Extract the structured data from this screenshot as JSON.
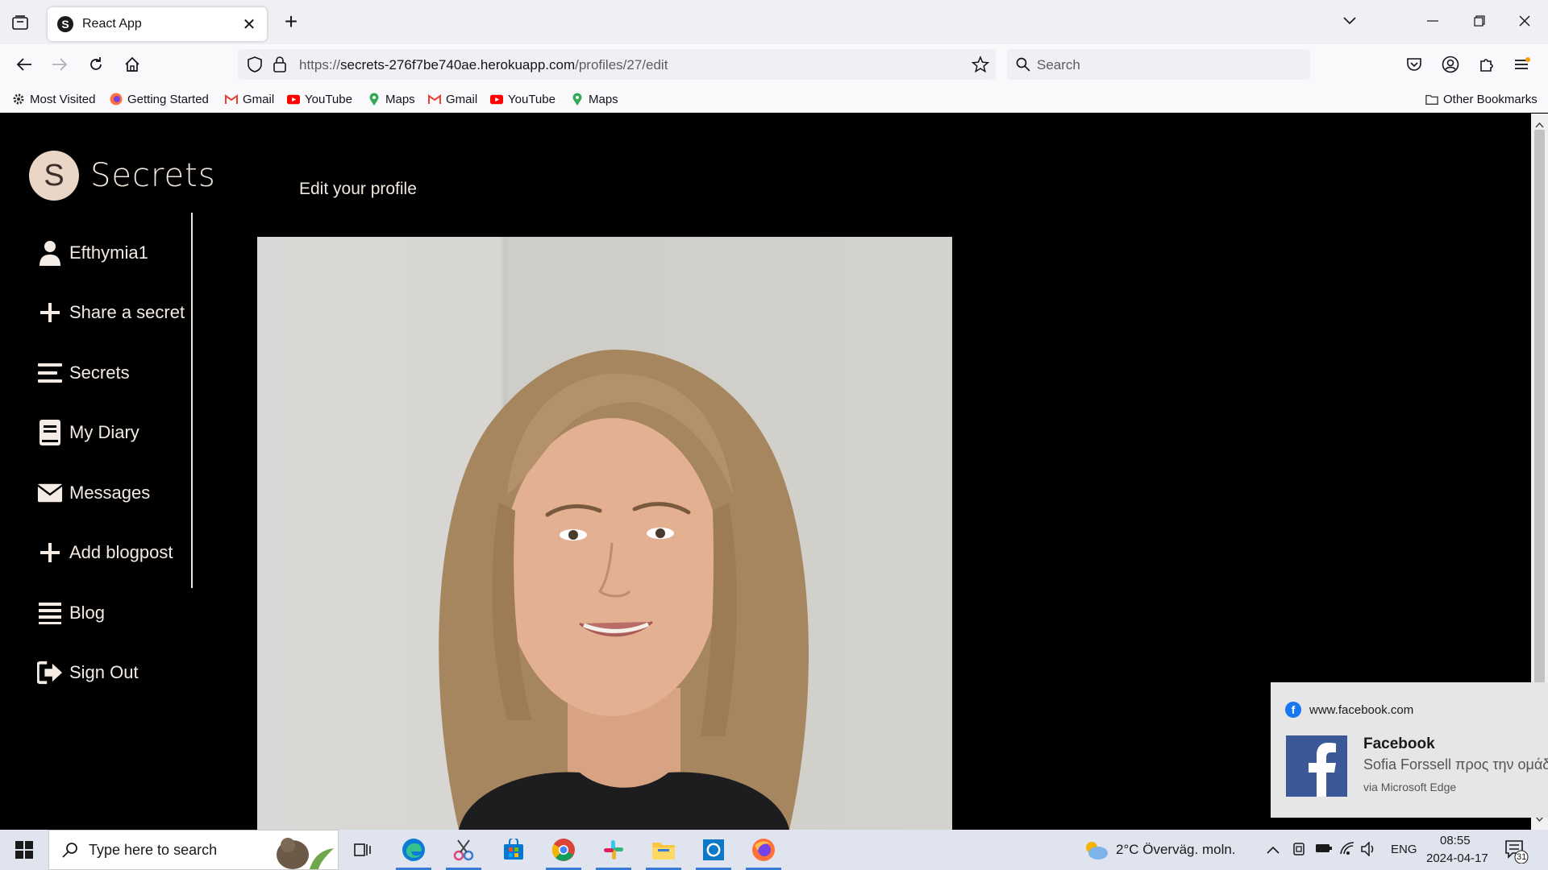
{
  "browser": {
    "tab_title": "React App",
    "tab_favicon_letter": "S",
    "url_prefix": "https://",
    "url_host": "secrets-276f7be740ae.herokuapp.com",
    "url_path": "/profiles/27/edit",
    "search_placeholder": "Search",
    "bookmarks": [
      {
        "label": "Most Visited",
        "icon": "gear-icon"
      },
      {
        "label": "Getting Started",
        "icon": "firefox-icon"
      },
      {
        "label": "Gmail",
        "icon": "gmail-icon"
      },
      {
        "label": "YouTube",
        "icon": "youtube-icon"
      },
      {
        "label": "Maps",
        "icon": "maps-icon"
      },
      {
        "label": "Gmail",
        "icon": "gmail-icon"
      },
      {
        "label": "YouTube",
        "icon": "youtube-icon"
      },
      {
        "label": "Maps",
        "icon": "maps-icon"
      }
    ],
    "other_bookmarks": "Other Bookmarks"
  },
  "app": {
    "logo_letter": "S",
    "logo_text": "Secrets",
    "page_title": "Edit your profile",
    "sidebar": [
      {
        "label": "Efthymia1",
        "icon": "user-icon"
      },
      {
        "label": "Share a secret",
        "icon": "plus-icon"
      },
      {
        "label": "Secrets",
        "icon": "menu-icon"
      },
      {
        "label": "My Diary",
        "icon": "book-icon"
      },
      {
        "label": "Messages",
        "icon": "envelope-icon"
      },
      {
        "label": "Add blogpost",
        "icon": "plus-icon"
      },
      {
        "label": "Blog",
        "icon": "list-icon"
      },
      {
        "label": "Sign Out",
        "icon": "sign-out-icon"
      }
    ]
  },
  "notification": {
    "source": "www.facebook.com",
    "title": "Facebook",
    "body": "Sofia Forssell προς την ομάδ",
    "via": "via Microsoft Edge"
  },
  "taskbar": {
    "search_placeholder": "Type here to search",
    "weather": "2°C  Överväg. moln.",
    "language": "ENG",
    "time": "08:55",
    "date": "2024-04-17",
    "notification_count": "31"
  },
  "colors": {
    "page_bg": "#000000",
    "sidebar_text": "#f4ece4",
    "logo_circle": "#e9d6c6",
    "facebook_blue": "#1877f2"
  }
}
